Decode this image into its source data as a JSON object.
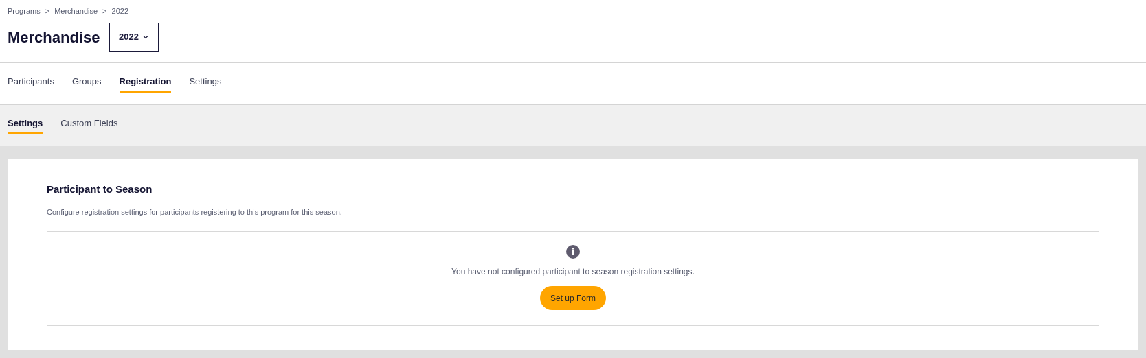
{
  "breadcrumb": {
    "items": [
      "Programs",
      "Merchandise",
      "2022"
    ],
    "separator": ">"
  },
  "header": {
    "title": "Merchandise",
    "season_select": {
      "value": "2022"
    }
  },
  "tabs": [
    {
      "label": "Participants",
      "selected": false
    },
    {
      "label": "Groups",
      "selected": false
    },
    {
      "label": "Registration",
      "selected": true
    },
    {
      "label": "Settings",
      "selected": false
    }
  ],
  "subtabs": [
    {
      "label": "Settings",
      "selected": true
    },
    {
      "label": "Custom Fields",
      "selected": false
    }
  ],
  "section": {
    "title": "Participant to Season",
    "description": "Configure registration settings for participants registering to this program for this season.",
    "empty_state": {
      "message": "You have not configured participant to season registration settings.",
      "button": "Set up Form"
    }
  }
}
